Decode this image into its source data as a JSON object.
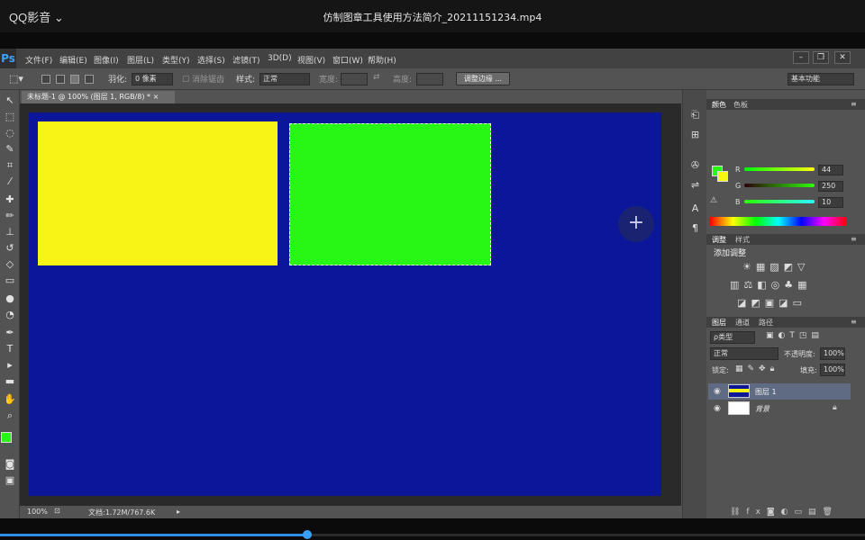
{
  "player": {
    "app_name": "QQ影音",
    "title": "仿制图章工具使用方法简介_20211151234.mp4",
    "progress_percent": 35.5
  },
  "ps": {
    "logo": "Ps",
    "menus": [
      "文件(F)",
      "编辑(E)",
      "图像(I)",
      "图层(L)",
      "类型(Y)",
      "选择(S)",
      "滤镜(T)",
      "3D(D)",
      "视图(V)",
      "窗口(W)",
      "帮助(H)"
    ],
    "options": {
      "feather_label": "羽化:",
      "feather_value": "0 像素",
      "antialias_label": "消除锯齿",
      "style_label": "样式:",
      "style_value": "正常",
      "width_label": "宽度:",
      "height_label": "高度:",
      "refine_button": "调整边缘 ...",
      "workspace": "基本功能"
    },
    "doc_tab": "未标题-1 @ 100% (图层 1, RGB/8) *",
    "status": {
      "zoom": "100%",
      "doc_info": "文档:1.72M/767.6K"
    },
    "colors": {
      "canvas_bg": "#0b1698",
      "yellow": "#f7f416",
      "green": "#27f714",
      "foreground": "#27f714",
      "background": "#f7f416"
    },
    "color_panel": {
      "tabs": [
        "颜色",
        "色板"
      ],
      "r_label": "R",
      "g_label": "G",
      "b_label": "B",
      "r_value": "44",
      "g_value": "250",
      "b_value": "10"
    },
    "adjust_panel": {
      "tabs": [
        "调整",
        "样式"
      ],
      "title": "添加调整"
    },
    "layers_panel": {
      "tabs": [
        "图层",
        "通道",
        "路径"
      ],
      "filter": "ρ类型",
      "blend_mode": "正常",
      "opacity_label": "不透明度:",
      "opacity_value": "100%",
      "lock_label": "锁定:",
      "fill_label": "填充:",
      "fill_value": "100%",
      "layers": [
        {
          "name": "图层 1"
        },
        {
          "name": "背景"
        }
      ]
    }
  }
}
